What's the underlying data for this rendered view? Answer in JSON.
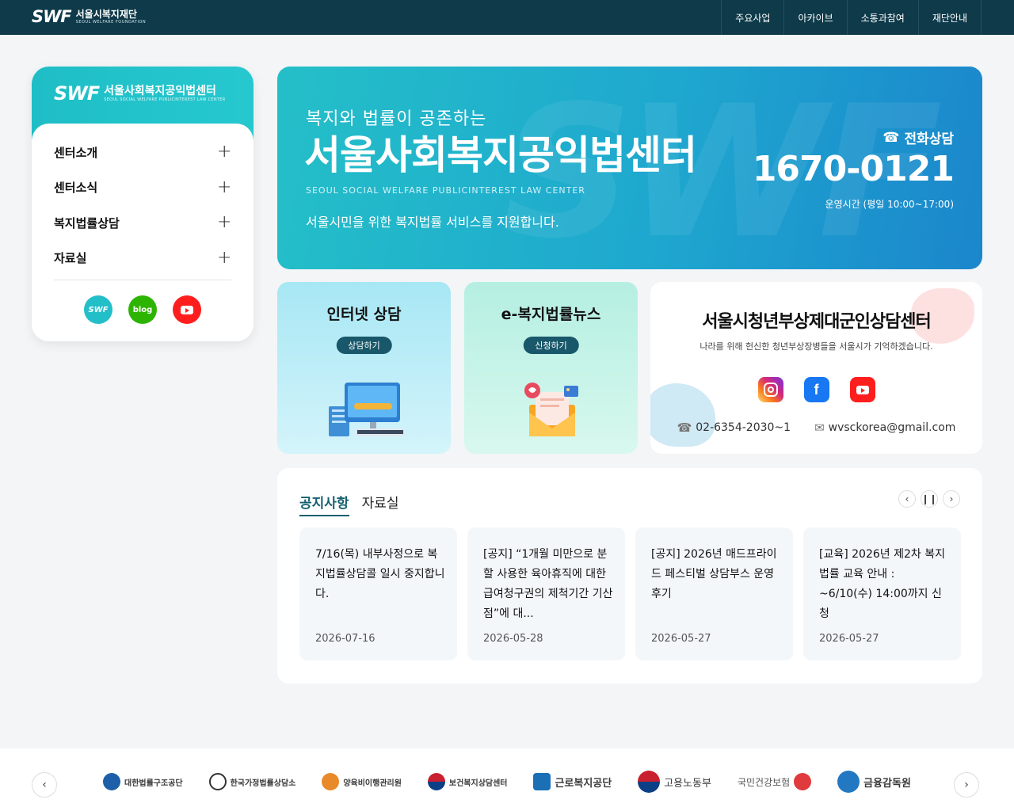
{
  "header": {
    "logo_mark": "SWF",
    "logo_name": "서울시복지재단",
    "logo_sub": "SEOUL WELFARE FOUNDATION",
    "nav": [
      "주요사업",
      "아카이브",
      "소통과참여",
      "재단안내"
    ]
  },
  "sidebar": {
    "logo_mark": "SWF",
    "logo_name": "서울사회복지공익법센터",
    "logo_sub": "SEOUL SOCIAL WELFARE PUBLICINTEREST LAW CENTER",
    "items": [
      {
        "label": "센터소개"
      },
      {
        "label": "센터소식"
      },
      {
        "label": "복지법률상담"
      },
      {
        "label": "자료실"
      }
    ],
    "sns": {
      "swf": "SWF",
      "blog": "blog"
    }
  },
  "hero": {
    "tagline": "복지와 법률이 공존하는",
    "title": "서울사회복지공익법센터",
    "subtitle_en": "SEOUL SOCIAL WELFARE PUBLICINTEREST LAW CENTER",
    "description": "서울시민을 위한 복지법률 서비스를 지원합니다.",
    "phone_label": "전화상담",
    "phone_number": "1670-0121",
    "hours": "운영시간 (평일 10:00~17:00)",
    "watermark": "SWF"
  },
  "cards": [
    {
      "title": "인터넷 상담",
      "button": "상담하기"
    },
    {
      "title": "e-복지법률뉴스",
      "button": "신청하기"
    }
  ],
  "youth_center": {
    "title": "서울시청년부상제대군인상담센터",
    "description": "나라를 위해 헌신한 청년부상장병들을 서울시가 기억하겠습니다.",
    "phone": "02-6354-2030~1",
    "email": "wvsckorea@gmail.com"
  },
  "notices": {
    "tabs": [
      "공지사항",
      "자료실"
    ],
    "posts": [
      {
        "title": "7/16(목) 내부사정으로 복지법률상담콜 일시 중지합니다.",
        "date": "2026-07-16"
      },
      {
        "title": "[공지] “1개월 미만으로 분할 사용한 육아휴직에 대한 급여청구권의 제척기간 기산점”에 대...",
        "date": "2026-05-28"
      },
      {
        "title": "[공지] 2026년 매드프라이드 페스티벌 상담부스 운영 후기",
        "date": "2026-05-27"
      },
      {
        "title": "[교육] 2026년 제2차 복지법률 교육 안내 : ~6/10(수) 14:00까지 신청",
        "date": "2026-05-27"
      }
    ]
  },
  "partners": [
    {
      "name": "대한법률구조공단",
      "color": "#1d5fa8"
    },
    {
      "name": "한국가정법률상담소",
      "color": "#333333"
    },
    {
      "name": "양육비이행관리원",
      "color": "#e88a2a"
    },
    {
      "name": "보건복지상담센터",
      "color": "#c8202f"
    },
    {
      "name": "근로복지공단",
      "color": "#1a6fb5"
    },
    {
      "name": "고용노동부",
      "color": "#0b3f86"
    },
    {
      "name": "국민건강보험",
      "color": "#e03a3e"
    },
    {
      "name": "금융감독원",
      "color": "#2378c2"
    }
  ]
}
